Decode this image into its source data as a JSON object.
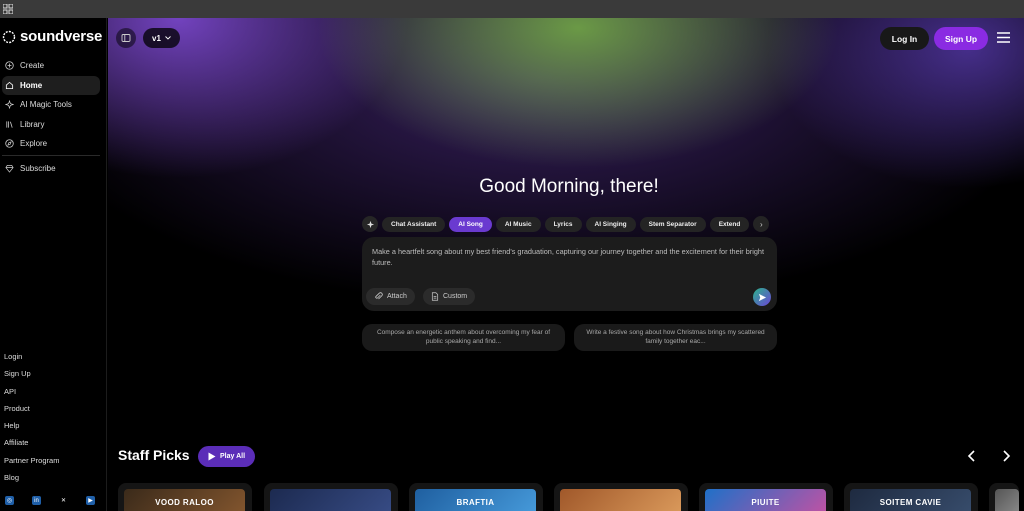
{
  "app": {
    "brand": "soundverse"
  },
  "sidebar": {
    "items": [
      {
        "label": "Create",
        "icon": "plus-circle-icon"
      },
      {
        "label": "Home",
        "icon": "home-icon",
        "active": true
      },
      {
        "label": "AI Magic Tools",
        "icon": "sparkle-icon"
      },
      {
        "label": "Library",
        "icon": "library-icon"
      },
      {
        "label": "Explore",
        "icon": "compass-icon"
      }
    ],
    "subscribe": {
      "label": "Subscribe",
      "icon": "gem-icon"
    },
    "footer_links": [
      "Login",
      "Sign Up",
      "API",
      "Product",
      "Help",
      "Affiliate",
      "Partner Program",
      "Blog"
    ],
    "socials": [
      "instagram-icon",
      "linkedin-icon",
      "x-icon",
      "youtube-icon"
    ]
  },
  "header": {
    "version": "v1",
    "login_label": "Log In",
    "signup_label": "Sign Up"
  },
  "main": {
    "greeting": "Good Morning, there!",
    "tools": [
      {
        "label": "Chat Assistant"
      },
      {
        "label": "AI Song",
        "active": true
      },
      {
        "label": "AI Music"
      },
      {
        "label": "Lyrics"
      },
      {
        "label": "AI Singing"
      },
      {
        "label": "Stem Separator"
      },
      {
        "label": "Extend"
      }
    ],
    "prompt": {
      "value": "Make a heartfelt song about my best friend's graduation, capturing our journey together and the excitement for their bright future.",
      "attach_label": "Attach",
      "custom_label": "Custom"
    },
    "suggestions": [
      "Compose an energetic anthem about overcoming my fear of public speaking and find...",
      "Write a festive song about how Christmas brings my scattered family together eac..."
    ]
  },
  "staff_picks": {
    "title": "Staff Picks",
    "play_all_label": "Play All",
    "cards": [
      {
        "title": "VOOD RALOO",
        "color": "#6b4a2a"
      },
      {
        "title": "",
        "color": "#2b3d6e"
      },
      {
        "title": "BRAFTIA",
        "color": "#2f7fc4"
      },
      {
        "title": "",
        "color": "#c47a3a"
      },
      {
        "title": "PIUITE",
        "color": "#2e8ad8"
      },
      {
        "title": "SOITEM CAVIE",
        "color": "#2c3c58"
      }
    ]
  },
  "colors": {
    "accent": "#8a2be2",
    "active_tool": "#6a3ad0",
    "background": "#000000"
  }
}
